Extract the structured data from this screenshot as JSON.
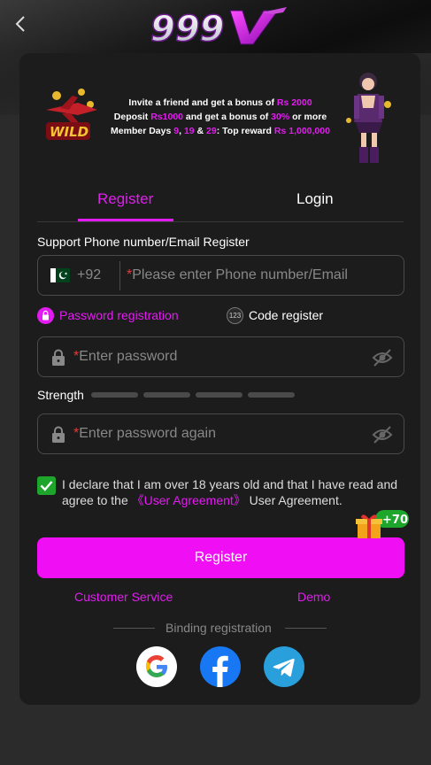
{
  "banner": {
    "line1_pre": "Invite a friend and get a bonus of ",
    "line1_hl": "Rs 2000",
    "line2_pre": "Deposit ",
    "line2_hl1": "Rs1000",
    "line2_mid": " and get a bonus of ",
    "line2_hl2": "30%",
    "line2_post": " or more",
    "line3_pre": "Member Days ",
    "line3_d1": "9",
    "line3_sep1": ", ",
    "line3_d2": "19",
    "line3_sep2": " & ",
    "line3_d3": "29",
    "line3_mid": ": Top reward ",
    "line3_hl": "Rs 1,000,000",
    "wild_label": "WILD"
  },
  "tabs": {
    "register": "Register",
    "login": "Login"
  },
  "form": {
    "support_label": "Support Phone number/Email Register",
    "country_code": "+92",
    "phone_placeholder": "Please enter Phone number/Email",
    "required_star": "*",
    "mode_password": "Password registration",
    "mode_code": "Code register",
    "mode_code_icon_text": "123",
    "password_placeholder": "Enter password",
    "strength_label": "Strength",
    "password_again_placeholder": "Enter password again",
    "declare_pre": "I declare that I am over 18 years old and that I have read and agree to the ",
    "agreement_link": "《User Agreement》",
    "declare_post": " User Agreement.",
    "agreed": true,
    "bonus_badge": "+70",
    "register_button": "Register"
  },
  "links": {
    "customer_service": "Customer Service",
    "demo": "Demo"
  },
  "binding": {
    "label": "Binding registration",
    "providers": [
      "google",
      "facebook",
      "telegram"
    ]
  },
  "colors": {
    "accent": "#e21cf0",
    "button": "#f00ff5",
    "check": "#1ea52c"
  }
}
